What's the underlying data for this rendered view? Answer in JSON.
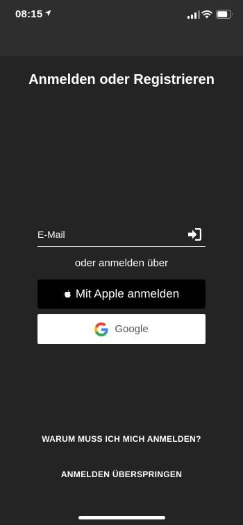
{
  "status_bar": {
    "time": "08:15",
    "icons": [
      "location-arrow-icon",
      "signal-icon",
      "wifi-icon",
      "battery-icon"
    ]
  },
  "title": "Anmelden oder Registrieren",
  "email": {
    "placeholder": "E-Mail",
    "value": "",
    "submit_icon": "sign-in-icon"
  },
  "divider_text": "oder anmelden über",
  "apple_button": {
    "label": "Mit Apple anmelden",
    "icon": "apple-icon"
  },
  "google_button": {
    "label": "Google",
    "icon": "google-icon"
  },
  "links": {
    "why": "WARUM MUSS ICH MICH ANMELDEN?",
    "skip": "ANMELDEN ÜBERSPRINGEN"
  },
  "colors": {
    "background": "#242424",
    "top_band": "#2e2e2e",
    "apple_button": "#000000",
    "google_button": "#ffffff"
  }
}
